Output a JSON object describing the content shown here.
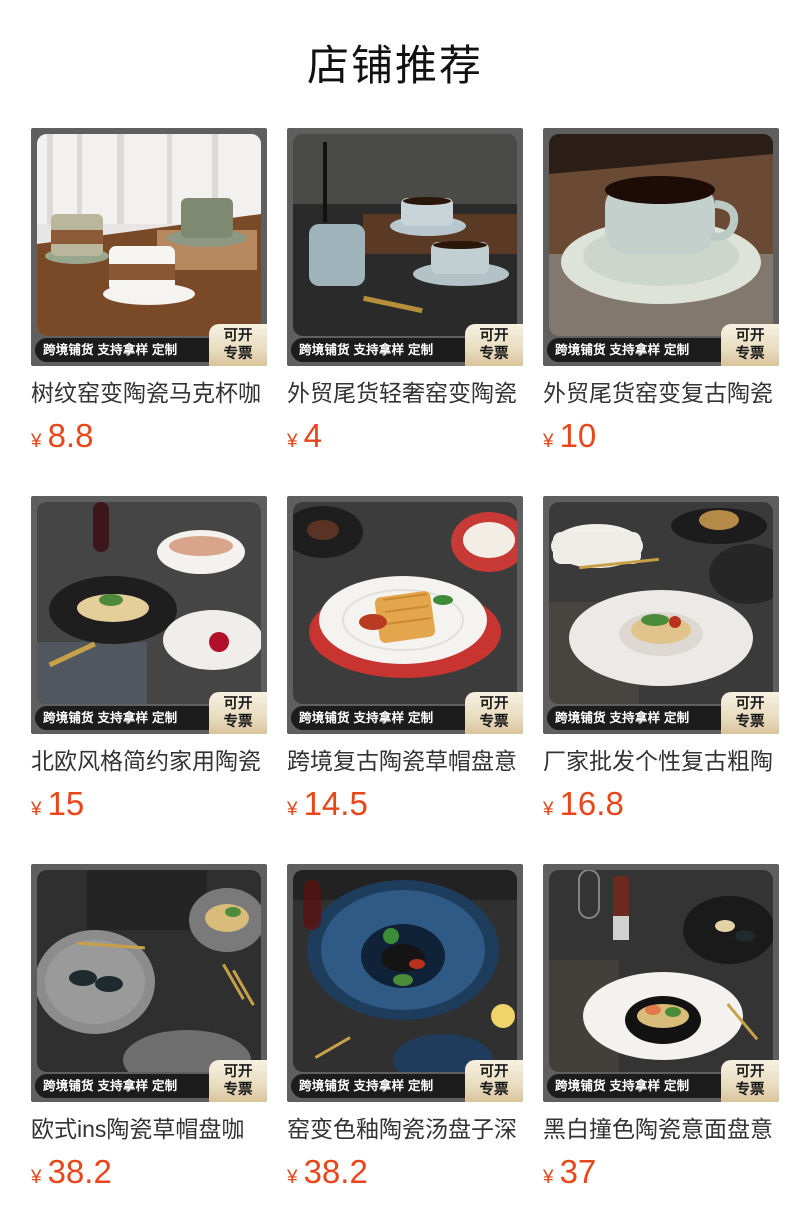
{
  "header": {
    "title": "店铺推荐"
  },
  "badge": {
    "strip_text": "跨境铺货 支持拿样 定制",
    "tag_line1": "可开",
    "tag_line2": "专票"
  },
  "currency_symbol": "¥",
  "products": [
    {
      "title": "树纹窑变陶瓷马克杯咖",
      "price": "8.8"
    },
    {
      "title": "外贸尾货轻奢窑变陶瓷",
      "price": "4"
    },
    {
      "title": "外贸尾货窑变复古陶瓷",
      "price": "10"
    },
    {
      "title": "北欧风格简约家用陶瓷",
      "price": "15"
    },
    {
      "title": "跨境复古陶瓷草帽盘意",
      "price": "14.5"
    },
    {
      "title": "厂家批发个性复古粗陶",
      "price": "16.8"
    },
    {
      "title": "欧式ins陶瓷草帽盘咖",
      "price": "38.2"
    },
    {
      "title": "窑变色釉陶瓷汤盘子深",
      "price": "38.2"
    },
    {
      "title": "黑白撞色陶瓷意面盘意",
      "price": "37"
    }
  ]
}
